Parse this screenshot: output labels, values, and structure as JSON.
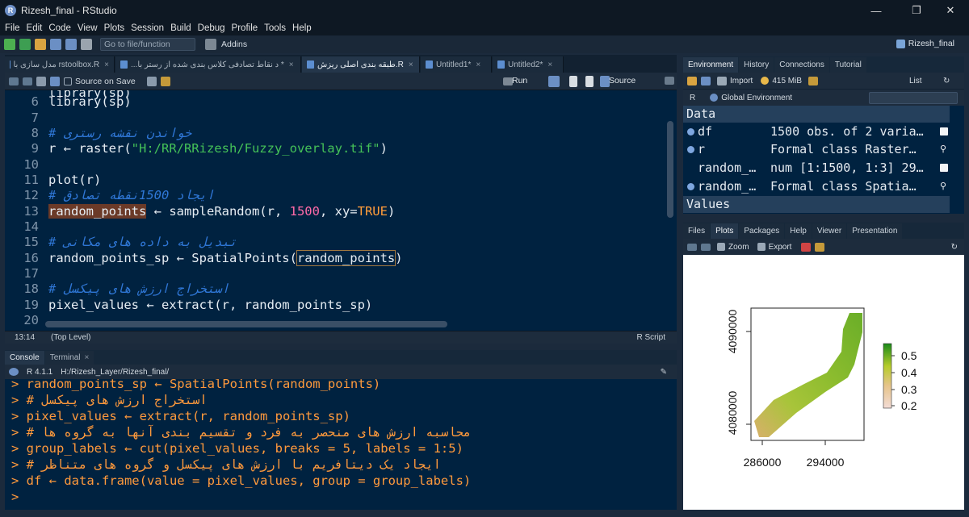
{
  "window": {
    "title": "Rizesh_final - RStudio",
    "logo": "R"
  },
  "menu": [
    "File",
    "Edit",
    "Code",
    "View",
    "Plots",
    "Session",
    "Build",
    "Debug",
    "Profile",
    "Tools",
    "Help"
  ],
  "toolbar": {
    "goto_placeholder": "Go to file/function",
    "addins": "Addins",
    "project": "Rizesh_final"
  },
  "editor": {
    "tabs": [
      {
        "label": "مدل سازی با rstoolbox.R",
        "active": false
      },
      {
        "label": "...د نقاط تصادفی کلاس بندی شده از رستر با *",
        "active": false
      },
      {
        "label": "طبقه بندی اصلی ریزش.R",
        "active": true
      },
      {
        "label": "Untitled1*",
        "active": false
      },
      {
        "label": "Untitled2*",
        "active": false
      }
    ],
    "source_on_save": "Source on Save",
    "run_label": "Run",
    "source_label": "Source",
    "lines": [
      {
        "n": "",
        "text": "library(sp)"
      },
      {
        "n": "6",
        "text": "library(sp)"
      },
      {
        "n": "7",
        "text": ""
      },
      {
        "n": "8",
        "comment": "# خواندن نقشه رستری"
      },
      {
        "n": "9",
        "pre": "r ← raster(",
        "string": "\"H:/RR/RRizesh/Fuzzy_overlay.tif\"",
        "post": ")"
      },
      {
        "n": "10",
        "text": ""
      },
      {
        "n": "11",
        "text": "plot(r)"
      },
      {
        "n": "12",
        "comment": "# ایجاد 1500نقطه تصادق"
      },
      {
        "n": "13",
        "hl": "random_points",
        "mid": " ← sampleRandom(r, ",
        "num": "1500",
        "mid2": ", xy=",
        "kw": "TRUE",
        "post": ")"
      },
      {
        "n": "14",
        "text": ""
      },
      {
        "n": "15",
        "comment": "# تبدیل به داده های مکانی"
      },
      {
        "n": "16",
        "pre": "random_points_sp ← SpatialPoints(",
        "boxed": "random_points",
        "post": ")"
      },
      {
        "n": "17",
        "text": ""
      },
      {
        "n": "18",
        "comment": "# استخراج ارزش های پیکسل"
      },
      {
        "n": "19",
        "text": "pixel_values ← extract(r, random_points_sp)"
      },
      {
        "n": "20",
        "text": ""
      }
    ],
    "status_pos": "13:14",
    "status_scope": "(Top Level)",
    "status_lang": "R Script"
  },
  "console": {
    "tabs": [
      "Console",
      "Terminal"
    ],
    "r_version": "R 4.1.1",
    "path": "H:/Rizesh_Layer/Rizesh_final/",
    "lines": [
      "> random_points_sp ← SpatialPoints(random_points)",
      "> # استخراج ارزش های پیکسل",
      "> pixel_values ← extract(r, random_points_sp)",
      "> # محاسبه ارزش های منحصر به فرد و تقسیم بندی آنها به گروه ها",
      "> group_labels ← cut(pixel_values, breaks = 5, labels = 1:5)",
      "> # ایجاد یک دیتافریم با ارزش های پیکسل و گروه های متناظر",
      "> df ← data.frame(value = pixel_values, group = group_labels)",
      "> "
    ]
  },
  "environment": {
    "tabs": [
      "Environment",
      "History",
      "Connections",
      "Tutorial"
    ],
    "import_label": "Import",
    "memory": "415 MiB",
    "list_label": "List",
    "lang": "R",
    "scope": "Global Environment",
    "sections": {
      "data": "Data",
      "values": "Values"
    },
    "rows": [
      {
        "name": "df",
        "value": "1500 obs. of 2 varia…"
      },
      {
        "name": "r",
        "value": "Formal class  Raster…"
      },
      {
        "name": "random_…",
        "value": "num [1:1500, 1:3] 29…"
      },
      {
        "name": "random_…",
        "value": "Formal class  Spatia…"
      }
    ]
  },
  "plots_pane": {
    "tabs": [
      "Files",
      "Plots",
      "Packages",
      "Help",
      "Viewer",
      "Presentation"
    ],
    "zoom_label": "Zoom",
    "export_label": "Export"
  },
  "chart_data": {
    "type": "heatmap",
    "title": "",
    "xlabel": "",
    "ylabel": "",
    "x_ticks": [
      "286000",
      "294000"
    ],
    "y_ticks": [
      "4080000",
      "4090000"
    ],
    "legend": {
      "placement": "right",
      "values": [
        "0.5",
        "0.4",
        "0.3",
        "0.2"
      ],
      "colors": [
        "#1a8a1a",
        "#c8d02a",
        "#e6c48a",
        "#f0d6d0"
      ]
    }
  }
}
